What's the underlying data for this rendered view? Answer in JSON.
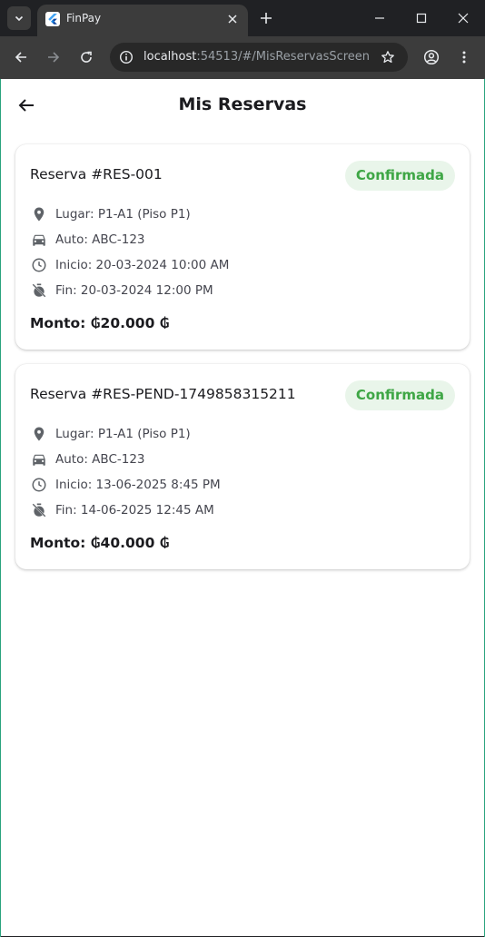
{
  "browser": {
    "tab_title": "FinPay",
    "url_host": "localhost",
    "url_rest": ":54513/#/MisReservasScreen"
  },
  "app": {
    "title": "Mis Reservas"
  },
  "reservations": [
    {
      "title": "Reserva #RES-001",
      "status": "Confirmada",
      "lugar": "Lugar: P1-A1 (Piso P1)",
      "auto": "Auto: ABC-123",
      "inicio": "Inicio: 20-03-2024 10:00 AM",
      "fin": "Fin: 20-03-2024 12:00 PM",
      "monto": "Monto: ₲20.000 ₲"
    },
    {
      "title": "Reserva #RES-PEND-1749858315211",
      "status": "Confirmada",
      "lugar": "Lugar: P1-A1 (Piso P1)",
      "auto": "Auto: ABC-123",
      "inicio": "Inicio: 13-06-2025 8:45 PM",
      "fin": "Fin: 14-06-2025 12:45 AM",
      "monto": "Monto: ₲40.000 ₲"
    }
  ],
  "colors": {
    "status_text": "#3ea645",
    "status_bg": "#e9f5ea",
    "icon": "#5f6368"
  },
  "icons": {
    "lugar": "location-pin-icon",
    "auto": "car-icon",
    "inicio": "clock-icon",
    "fin": "timer-off-icon"
  }
}
